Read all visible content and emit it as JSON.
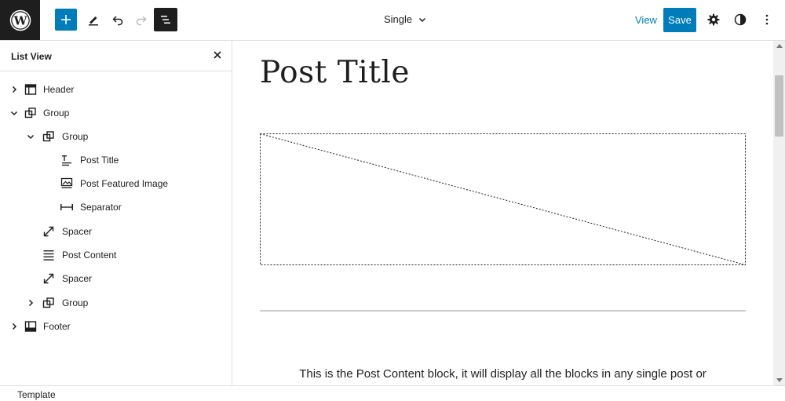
{
  "topbar": {
    "template_name": "Single",
    "view_label": "View",
    "save_label": "Save"
  },
  "list_view": {
    "title": "List View",
    "items": [
      {
        "label": "Header",
        "icon": "header-icon",
        "depth": 0,
        "chevron": "right"
      },
      {
        "label": "Group",
        "icon": "group-icon",
        "depth": 0,
        "chevron": "down"
      },
      {
        "label": "Group",
        "icon": "group-icon",
        "depth": 1,
        "chevron": "down"
      },
      {
        "label": "Post Title",
        "icon": "post-title-icon",
        "depth": 2,
        "chevron": "none"
      },
      {
        "label": "Post Featured Image",
        "icon": "featured-image-icon",
        "depth": 2,
        "chevron": "none"
      },
      {
        "label": "Separator",
        "icon": "separator-icon",
        "depth": 2,
        "chevron": "none"
      },
      {
        "label": "Spacer",
        "icon": "spacer-icon",
        "depth": 1,
        "chevron": "none"
      },
      {
        "label": "Post Content",
        "icon": "post-content-icon",
        "depth": 1,
        "chevron": "none"
      },
      {
        "label": "Spacer",
        "icon": "spacer-icon",
        "depth": 1,
        "chevron": "none"
      },
      {
        "label": "Group",
        "icon": "group-icon",
        "depth": 1,
        "chevron": "right"
      },
      {
        "label": "Footer",
        "icon": "footer-icon",
        "depth": 0,
        "chevron": "right"
      }
    ]
  },
  "canvas": {
    "post_title": "Post Title",
    "post_content": "This is the Post Content block, it will display all the blocks in any single post or"
  },
  "footer": {
    "breadcrumb": "Template"
  },
  "colors": {
    "accent": "#007cba",
    "dark": "#1e1e1e",
    "border": "#e0e0e0"
  }
}
